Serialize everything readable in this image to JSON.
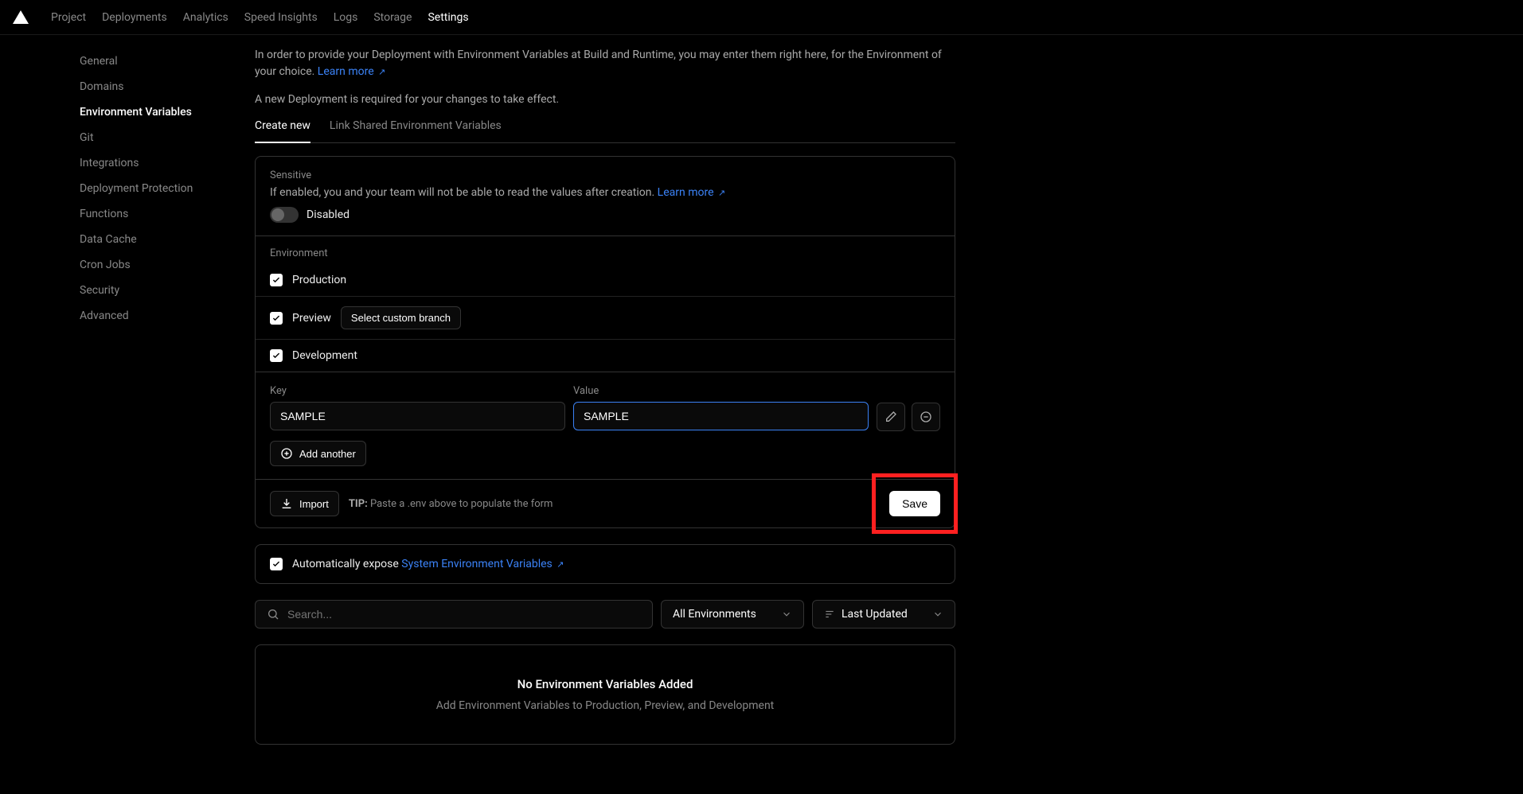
{
  "topnav": {
    "items": [
      "Project",
      "Deployments",
      "Analytics",
      "Speed Insights",
      "Logs",
      "Storage",
      "Settings"
    ],
    "activeIndex": 6
  },
  "sidebar": {
    "items": [
      "General",
      "Domains",
      "Environment Variables",
      "Git",
      "Integrations",
      "Deployment Protection",
      "Functions",
      "Data Cache",
      "Cron Jobs",
      "Security",
      "Advanced"
    ],
    "activeIndex": 2
  },
  "description": {
    "line1": "In order to provide your Deployment with Environment Variables at Build and Runtime, you may enter them right here, for the Environment of your choice.",
    "learnMore": "Learn more",
    "line2": "A new Deployment is required for your changes to take effect."
  },
  "tabs": {
    "items": [
      "Create new",
      "Link Shared Environment Variables"
    ],
    "activeIndex": 0
  },
  "sensitive": {
    "title": "Sensitive",
    "desc": "If enabled, you and your team will not be able to read the values after creation.",
    "learnMore": "Learn more",
    "status": "Disabled"
  },
  "environment": {
    "title": "Environment",
    "rows": [
      {
        "label": "Production",
        "checked": true
      },
      {
        "label": "Preview",
        "checked": true,
        "branchBtn": "Select custom branch"
      },
      {
        "label": "Development",
        "checked": true
      }
    ]
  },
  "kv": {
    "keyLabel": "Key",
    "valueLabel": "Value",
    "keyValue": "SAMPLE",
    "valueValue": "SAMPLE",
    "addAnother": "Add another"
  },
  "footer": {
    "import": "Import",
    "tipLabel": "TIP:",
    "tipText": "Paste a .env above to populate the form",
    "save": "Save"
  },
  "expose": {
    "prefix": "Automatically expose",
    "link": "System Environment Variables"
  },
  "filters": {
    "searchPlaceholder": "Search...",
    "envDropdown": "All Environments",
    "sortDropdown": "Last Updated"
  },
  "empty": {
    "title": "No Environment Variables Added",
    "sub": "Add Environment Variables to Production, Preview, and Development"
  }
}
